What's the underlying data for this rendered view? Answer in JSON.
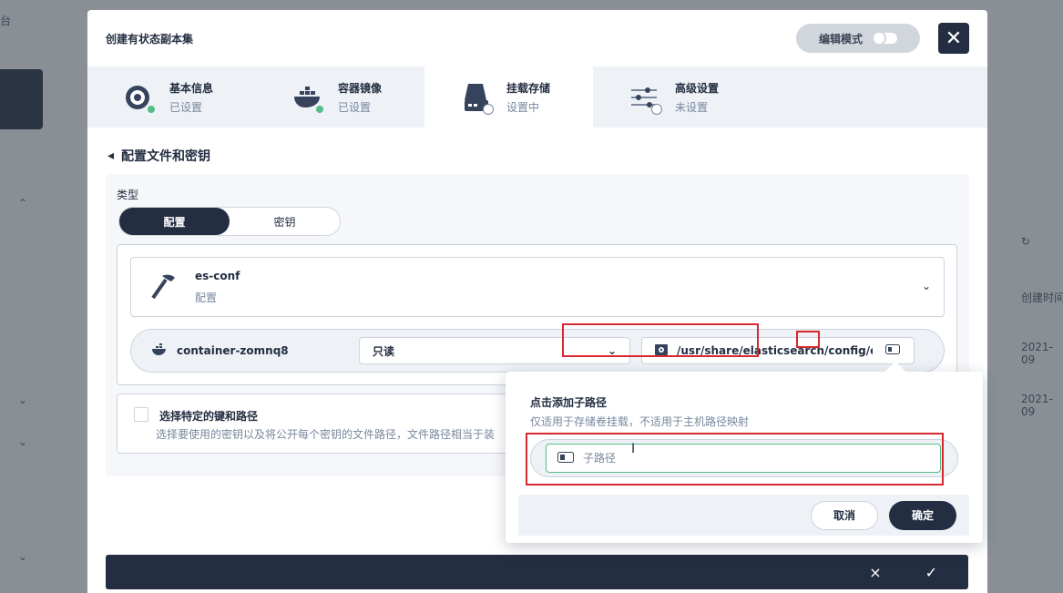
{
  "background": {
    "partial_label_top_left": "台",
    "right_col_header": "创建时间",
    "right_col_values": [
      "2021-09",
      "2021-09"
    ]
  },
  "modal": {
    "title": "创建有状态副本集",
    "edit_mode_label": "编辑模式",
    "steps": [
      {
        "title": "基本信息",
        "status": "已设置",
        "icon": "disk-icon"
      },
      {
        "title": "容器镜像",
        "status": "已设置",
        "icon": "docker-whale-icon"
      },
      {
        "title": "挂载存储",
        "status": "设置中",
        "icon": "storage-drive-icon"
      },
      {
        "title": "高级设置",
        "status": "未设置",
        "icon": "sliders-icon"
      }
    ],
    "section_title": "配置文件和密钥",
    "type_label": "类型",
    "type_options": [
      "配置",
      "密钥"
    ],
    "type_selected": "配置",
    "config": {
      "name": "es-conf",
      "kind": "配置"
    },
    "mount": {
      "container": "container-zomnq8",
      "access_mode": "只读",
      "path": "/usr/share/elasticsearch/config/elasti"
    },
    "specific_keys": {
      "title": "选择特定的键和路径",
      "desc": "选择要使用的密钥以及将公开每个密钥的文件路径，文件路径相当于装"
    }
  },
  "popover": {
    "title": "点击添加子路径",
    "desc": "仅适用于存储卷挂载，不适用于主机路径映射",
    "input_placeholder": "子路径",
    "cancel_label": "取消",
    "ok_label": "确定"
  },
  "footer": {
    "cancel_symbol": "×",
    "ok_symbol": "✓"
  },
  "colors": {
    "primary_dark": "#242e42",
    "success_green": "#55bc8a",
    "highlight_red": "#d8282f"
  }
}
